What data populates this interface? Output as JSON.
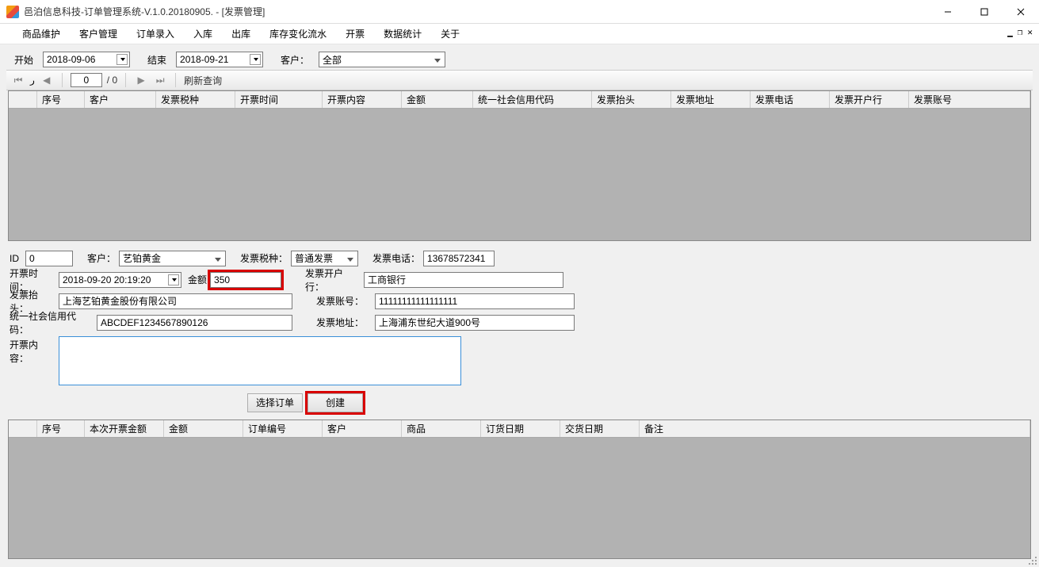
{
  "window": {
    "title": "邑泊信息科技-订单管理系统-V.1.0.20180905. - [发票管理]"
  },
  "menu": {
    "items": [
      "商品维护",
      "客户管理",
      "订单录入",
      "入库",
      "出库",
      "库存变化流水",
      "开票",
      "数据统计",
      "关于"
    ]
  },
  "filter": {
    "start_label": "开始",
    "start_date": "2018-09-06",
    "end_label": "结束",
    "end_date": "2018-09-21",
    "customer_label": "客户：",
    "customer_value": "全部"
  },
  "pager": {
    "current": "0",
    "total": "/ 0",
    "refresh_label": "刷新查询"
  },
  "grid1_headers": [
    "序号",
    "客户",
    "发票税种",
    "开票时间",
    "开票内容",
    "金额",
    "统一社会信用代码",
    "发票抬头",
    "发票地址",
    "发票电话",
    "发票开户行",
    "发票账号"
  ],
  "form": {
    "id_label": "ID",
    "id_value": "0",
    "customer_label": "客户：",
    "customer_value": "艺铂黄金",
    "tax_label": "发票税种：",
    "tax_value": "普通发票",
    "phone_label": "发票电话：",
    "phone_value": "13678572341",
    "time_label": "开票时间：",
    "time_value": "2018-09-20 20:19:20",
    "amount_label": "金额",
    "amount_value": "350",
    "bank_label": "发票开户行：",
    "bank_value": "工商银行",
    "title_label": "发票抬头：",
    "title_value": "上海艺铂黄金股份有限公司",
    "account_label": "发票账号：",
    "account_value": "11111111111111111",
    "uscc_label": "统一社会信用代码：",
    "uscc_value": "ABCDEF1234567890126",
    "address_label": "发票地址：",
    "address_value": "上海浦东世纪大道900号",
    "content_label": "开票内容：",
    "content_value": ""
  },
  "buttons": {
    "select_order": "选择订单",
    "create": "创建"
  },
  "grid2_headers": [
    "序号",
    "本次开票金额",
    "金额",
    "订单编号",
    "客户",
    "商品",
    "订货日期",
    "交货日期",
    "备注"
  ]
}
